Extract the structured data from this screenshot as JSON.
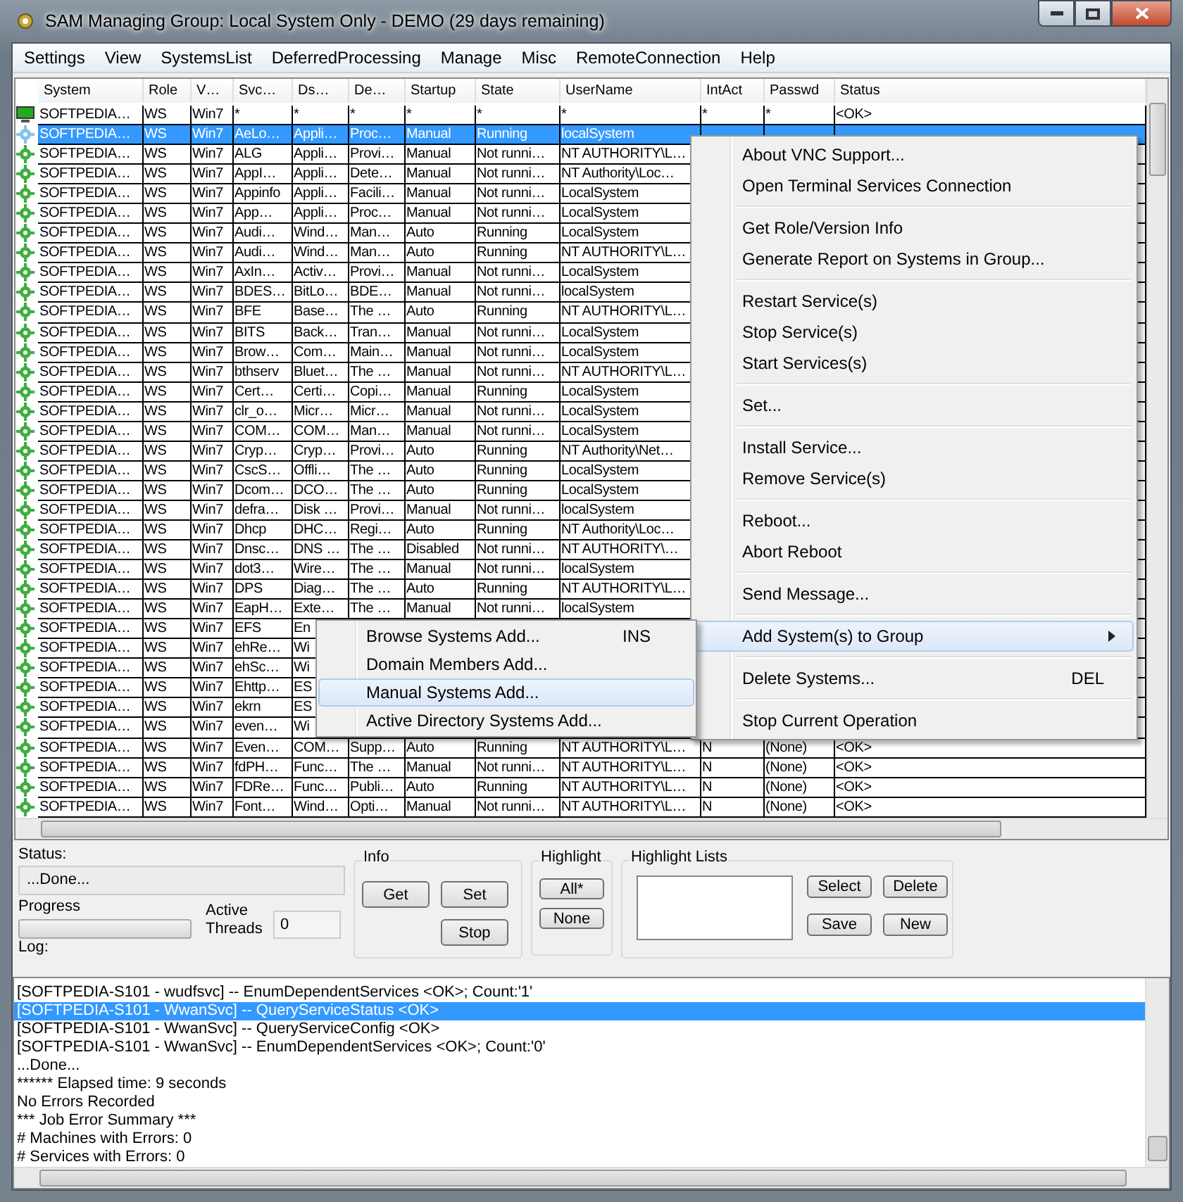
{
  "window": {
    "title": "SAM Managing Group: Local System Only - DEMO (29 days remaining)"
  },
  "menu_bar": [
    "Settings",
    "View",
    "SystemsList",
    "DeferredProcessing",
    "Manage",
    "Misc",
    "RemoteConnection",
    "Help"
  ],
  "table": {
    "columns": [
      "System",
      "Role",
      "V…",
      "Svc…",
      "Ds…",
      "De…",
      "Startup",
      "State",
      "UserName",
      "IntAct",
      "Passwd",
      "Status"
    ],
    "rows": [
      {
        "kind": "computer",
        "selected": false,
        "cells": [
          "SOFTPEDIA…",
          "WS",
          "Win7",
          "*",
          "*",
          "*",
          "*",
          "*",
          "*",
          "*",
          "*",
          "<OK>"
        ]
      },
      {
        "kind": "service",
        "selected": true,
        "cells": [
          "SOFTPEDIA…",
          "WS",
          "Win7",
          "AeLo…",
          "Appli…",
          "Proc…",
          "Manual",
          "Running",
          "localSystem"
        ]
      },
      {
        "kind": "service",
        "selected": false,
        "cells": [
          "SOFTPEDIA…",
          "WS",
          "Win7",
          "ALG",
          "Appli…",
          "Provi…",
          "Manual",
          "Not runni…",
          "NT AUTHORITY\\L…"
        ]
      },
      {
        "kind": "service",
        "selected": false,
        "cells": [
          "SOFTPEDIA…",
          "WS",
          "Win7",
          "AppI…",
          "Appli…",
          "Dete…",
          "Manual",
          "Not runni…",
          "NT Authority\\Loc…"
        ]
      },
      {
        "kind": "service",
        "selected": false,
        "cells": [
          "SOFTPEDIA…",
          "WS",
          "Win7",
          "Appinfo",
          "Appli…",
          "Facili…",
          "Manual",
          "Not runni…",
          "LocalSystem"
        ]
      },
      {
        "kind": "service",
        "selected": false,
        "cells": [
          "SOFTPEDIA…",
          "WS",
          "Win7",
          "App…",
          "Appli…",
          "Proc…",
          "Manual",
          "Not runni…",
          "LocalSystem"
        ]
      },
      {
        "kind": "service",
        "selected": false,
        "cells": [
          "SOFTPEDIA…",
          "WS",
          "Win7",
          "Audi…",
          "Wind…",
          "Man…",
          "Auto",
          "Running",
          "LocalSystem"
        ]
      },
      {
        "kind": "service",
        "selected": false,
        "cells": [
          "SOFTPEDIA…",
          "WS",
          "Win7",
          "Audi…",
          "Wind…",
          "Man…",
          "Auto",
          "Running",
          "NT AUTHORITY\\L…"
        ]
      },
      {
        "kind": "service",
        "selected": false,
        "cells": [
          "SOFTPEDIA…",
          "WS",
          "Win7",
          "AxIn…",
          "Activ…",
          "Provi…",
          "Manual",
          "Not runni…",
          "LocalSystem"
        ]
      },
      {
        "kind": "service",
        "selected": false,
        "cells": [
          "SOFTPEDIA…",
          "WS",
          "Win7",
          "BDES…",
          "BitLo…",
          "BDE…",
          "Manual",
          "Not runni…",
          "localSystem"
        ]
      },
      {
        "kind": "service",
        "selected": false,
        "cells": [
          "SOFTPEDIA…",
          "WS",
          "Win7",
          "BFE",
          "Base…",
          "The …",
          "Auto",
          "Running",
          "NT AUTHORITY\\L…"
        ]
      },
      {
        "kind": "service",
        "selected": false,
        "cells": [
          "SOFTPEDIA…",
          "WS",
          "Win7",
          "BITS",
          "Back…",
          "Tran…",
          "Manual",
          "Not runni…",
          "LocalSystem"
        ]
      },
      {
        "kind": "service",
        "selected": false,
        "cells": [
          "SOFTPEDIA…",
          "WS",
          "Win7",
          "Brow…",
          "Com…",
          "Main…",
          "Manual",
          "Not runni…",
          "LocalSystem"
        ]
      },
      {
        "kind": "service",
        "selected": false,
        "cells": [
          "SOFTPEDIA…",
          "WS",
          "Win7",
          "bthserv",
          "Bluet…",
          "The …",
          "Manual",
          "Not runni…",
          "NT AUTHORITY\\L…"
        ]
      },
      {
        "kind": "service",
        "selected": false,
        "cells": [
          "SOFTPEDIA…",
          "WS",
          "Win7",
          "Cert…",
          "Certi…",
          "Copi…",
          "Manual",
          "Running",
          "LocalSystem"
        ]
      },
      {
        "kind": "service",
        "selected": false,
        "cells": [
          "SOFTPEDIA…",
          "WS",
          "Win7",
          "clr_o…",
          "Micr…",
          "Micr…",
          "Manual",
          "Not runni…",
          "LocalSystem"
        ]
      },
      {
        "kind": "service",
        "selected": false,
        "cells": [
          "SOFTPEDIA…",
          "WS",
          "Win7",
          "COM…",
          "COM…",
          "Man…",
          "Manual",
          "Not runni…",
          "LocalSystem"
        ]
      },
      {
        "kind": "service",
        "selected": false,
        "cells": [
          "SOFTPEDIA…",
          "WS",
          "Win7",
          "Cryp…",
          "Cryp…",
          "Provi…",
          "Auto",
          "Running",
          "NT Authority\\Net…"
        ]
      },
      {
        "kind": "service",
        "selected": false,
        "cells": [
          "SOFTPEDIA…",
          "WS",
          "Win7",
          "CscS…",
          "Offli…",
          "The …",
          "Auto",
          "Running",
          "LocalSystem"
        ]
      },
      {
        "kind": "service",
        "selected": false,
        "cells": [
          "SOFTPEDIA…",
          "WS",
          "Win7",
          "Dcom…",
          "DCO…",
          "The …",
          "Auto",
          "Running",
          "LocalSystem"
        ]
      },
      {
        "kind": "service",
        "selected": false,
        "cells": [
          "SOFTPEDIA…",
          "WS",
          "Win7",
          "defra…",
          "Disk …",
          "Provi…",
          "Manual",
          "Not runni…",
          "localSystem"
        ]
      },
      {
        "kind": "service",
        "selected": false,
        "cells": [
          "SOFTPEDIA…",
          "WS",
          "Win7",
          "Dhcp",
          "DHC…",
          "Regi…",
          "Auto",
          "Running",
          "NT Authority\\Loc…"
        ]
      },
      {
        "kind": "service",
        "selected": false,
        "cells": [
          "SOFTPEDIA…",
          "WS",
          "Win7",
          "Dnsc…",
          "DNS …",
          "The …",
          "Disabled",
          "Not runni…",
          "NT AUTHORITY\\…"
        ]
      },
      {
        "kind": "service",
        "selected": false,
        "cells": [
          "SOFTPEDIA…",
          "WS",
          "Win7",
          "dot3…",
          "Wire…",
          "The …",
          "Manual",
          "Not runni…",
          "localSystem"
        ]
      },
      {
        "kind": "service",
        "selected": false,
        "cells": [
          "SOFTPEDIA…",
          "WS",
          "Win7",
          "DPS",
          "Diag…",
          "The …",
          "Auto",
          "Running",
          "NT AUTHORITY\\L…"
        ]
      },
      {
        "kind": "service",
        "selected": false,
        "cells": [
          "SOFTPEDIA…",
          "WS",
          "Win7",
          "EapH…",
          "Exte…",
          "The …",
          "Manual",
          "Not runni…",
          "localSystem"
        ]
      },
      {
        "kind": "service",
        "selected": false,
        "cells": [
          "SOFTPEDIA…",
          "WS",
          "Win7",
          "EFS",
          "En"
        ]
      },
      {
        "kind": "service",
        "selected": false,
        "cells": [
          "SOFTPEDIA…",
          "WS",
          "Win7",
          "ehRe…",
          "Wi"
        ]
      },
      {
        "kind": "service",
        "selected": false,
        "cells": [
          "SOFTPEDIA…",
          "WS",
          "Win7",
          "ehSc…",
          "Wi"
        ]
      },
      {
        "kind": "service",
        "selected": false,
        "cells": [
          "SOFTPEDIA…",
          "WS",
          "Win7",
          "Ehttp…",
          "ES"
        ]
      },
      {
        "kind": "service",
        "selected": false,
        "cells": [
          "SOFTPEDIA…",
          "WS",
          "Win7",
          "ekrn",
          "ES"
        ]
      },
      {
        "kind": "service",
        "selected": false,
        "cells": [
          "SOFTPEDIA…",
          "WS",
          "Win7",
          "even…",
          "Wi"
        ]
      },
      {
        "kind": "service",
        "selected": false,
        "cells": [
          "SOFTPEDIA…",
          "WS",
          "Win7",
          "Even…",
          "COM…",
          "Supp…",
          "Auto",
          "Running",
          "NT AUTHORITY\\L…",
          "N",
          "(None)",
          "<OK>"
        ]
      },
      {
        "kind": "service",
        "selected": false,
        "cells": [
          "SOFTPEDIA…",
          "WS",
          "Win7",
          "fdPH…",
          "Func…",
          "The …",
          "Manual",
          "Not runni…",
          "NT AUTHORITY\\L…",
          "N",
          "(None)",
          "<OK>"
        ]
      },
      {
        "kind": "service",
        "selected": false,
        "cells": [
          "SOFTPEDIA…",
          "WS",
          "Win7",
          "FDRe…",
          "Func…",
          "Publi…",
          "Auto",
          "Running",
          "NT AUTHORITY\\L…",
          "N",
          "(None)",
          "<OK>"
        ]
      },
      {
        "kind": "service",
        "selected": false,
        "cells": [
          "SOFTPEDIA…",
          "WS",
          "Win7",
          "Font…",
          "Wind…",
          "Opti…",
          "Manual",
          "Not runni…",
          "NT AUTHORITY\\L…",
          "N",
          "(None)",
          "<OK>"
        ]
      }
    ]
  },
  "context_menu": {
    "groups": [
      [
        {
          "label": "About VNC Support...",
          "selected": false,
          "has_submenu": false
        },
        {
          "label": "Open Terminal Services Connection",
          "selected": false,
          "has_submenu": false
        }
      ],
      [
        {
          "label": "Get Role/Version Info",
          "selected": false,
          "has_submenu": false
        },
        {
          "label": "Generate Report on Systems in Group...",
          "selected": false,
          "has_submenu": false
        }
      ],
      [
        {
          "label": "Restart Service(s)",
          "selected": false,
          "has_submenu": false
        },
        {
          "label": "Stop Service(s)",
          "selected": false,
          "has_submenu": false
        },
        {
          "label": "Start Services(s)",
          "selected": false,
          "has_submenu": false
        }
      ],
      [
        {
          "label": "Set...",
          "selected": false,
          "has_submenu": false
        }
      ],
      [
        {
          "label": "Install Service...",
          "selected": false,
          "has_submenu": false
        },
        {
          "label": "Remove Service(s)",
          "selected": false,
          "has_submenu": false
        }
      ],
      [
        {
          "label": "Reboot...",
          "selected": false,
          "has_submenu": false
        },
        {
          "label": "Abort Reboot",
          "selected": false,
          "has_submenu": false
        }
      ],
      [
        {
          "label": "Send Message...",
          "selected": false,
          "has_submenu": false
        }
      ],
      [
        {
          "label": "Add System(s) to Group",
          "selected": true,
          "has_submenu": true
        }
      ],
      [
        {
          "label": "Delete Systems...",
          "shortcut": "DEL",
          "selected": false,
          "has_submenu": false
        }
      ],
      [
        {
          "label": "Stop Current Operation",
          "selected": false,
          "has_submenu": false
        }
      ]
    ]
  },
  "submenu": {
    "items": [
      {
        "label": "Browse Systems Add...",
        "shortcut": "INS",
        "selected": false
      },
      {
        "label": "Domain Members Add...",
        "selected": false
      },
      {
        "label": "Manual Systems Add...",
        "selected": true
      },
      {
        "label": "Active Directory Systems Add...",
        "selected": false
      }
    ]
  },
  "status": {
    "label": "Status:",
    "value": "...Done..."
  },
  "progress": {
    "label": "Progress",
    "level": 0
  },
  "active_threads": {
    "label": "Active Threads",
    "value": "0"
  },
  "info": {
    "title": "Info",
    "buttons": [
      "Get",
      "Set",
      "Stop"
    ]
  },
  "highlight": {
    "title": "Highlight",
    "buttons": [
      "All*",
      "None"
    ]
  },
  "highlight_lists": {
    "title": "Highlight Lists",
    "buttons": [
      "Select",
      "Delete",
      "Save",
      "New"
    ]
  },
  "log": {
    "label": "Log:",
    "lines": [
      {
        "text": "[SOFTPEDIA-S101 - wudfsvc] -- EnumDependentServices <OK>; Count:'1'",
        "selected": false
      },
      {
        "text": "[SOFTPEDIA-S101 - WwanSvc] -- QueryServiceStatus <OK>",
        "selected": true
      },
      {
        "text": "[SOFTPEDIA-S101 - WwanSvc] -- QueryServiceConfig <OK>",
        "selected": false
      },
      {
        "text": "[SOFTPEDIA-S101 - WwanSvc] -- EnumDependentServices <OK>; Count:'0'",
        "selected": false
      },
      {
        "text": "...Done...",
        "selected": false
      },
      {
        "text": "****** Elapsed time: 9 seconds",
        "selected": false
      },
      {
        "text": "No Errors Recorded",
        "selected": false
      },
      {
        "text": "*** Job Error Summary ***",
        "selected": false
      },
      {
        "text": "# Machines with Errors: 0",
        "selected": false
      },
      {
        "text": "# Services with Errors: 0",
        "selected": false
      }
    ]
  }
}
